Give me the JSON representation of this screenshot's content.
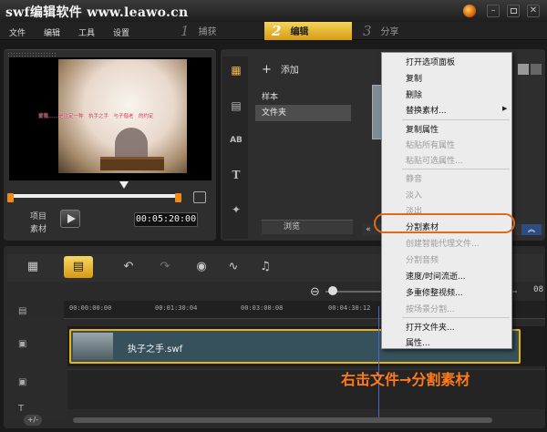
{
  "window": {
    "title": "swf编辑软件 www.leawo.cn",
    "minimize_glyph": "–",
    "close_glyph": "✕"
  },
  "menubar": [
    "文件",
    "编辑",
    "工具",
    "设置"
  ],
  "steps": [
    {
      "num": "1",
      "label": "捕获"
    },
    {
      "num": "2",
      "label": "编辑"
    },
    {
      "num": "3",
      "label": "分享"
    }
  ],
  "preview": {
    "subtitle": "爱我……是注定一种　执手之手　与子偕老　的约定",
    "project_label": "项目",
    "clip_label": "素材",
    "timecode": "00:05:20:00"
  },
  "library": {
    "add_label": "添加",
    "categories": [
      "样本",
      "文件夹"
    ],
    "browse_label": "浏览",
    "icons": [
      "media-icon",
      "transition-icon",
      "title-ab-icon",
      "text-t-icon",
      "effect-icon"
    ]
  },
  "context_menu": {
    "items": [
      {
        "label": "打开选项面板",
        "enabled": true
      },
      {
        "label": "复制",
        "enabled": true
      },
      {
        "label": "删除",
        "enabled": true
      },
      {
        "label": "替换素材...",
        "enabled": true,
        "submenu": true
      },
      {
        "label": "复制属性",
        "enabled": true
      },
      {
        "label": "粘贴所有属性",
        "enabled": false
      },
      {
        "label": "粘贴可选属性...",
        "enabled": false
      },
      {
        "label": "静音",
        "enabled": false
      },
      {
        "label": "淡入",
        "enabled": false
      },
      {
        "label": "淡出",
        "enabled": false
      },
      {
        "label": "分割素材",
        "enabled": true,
        "highlighted": true
      },
      {
        "label": "创建智能代理文件...",
        "enabled": false
      },
      {
        "label": "分割音频",
        "enabled": false
      },
      {
        "label": "速度/时间流逝...",
        "enabled": true
      },
      {
        "label": "多重修整视频...",
        "enabled": true
      },
      {
        "label": "按场景分割...",
        "enabled": false
      },
      {
        "label": "打开文件夹...",
        "enabled": true
      },
      {
        "label": "属性...",
        "enabled": true
      }
    ]
  },
  "timeline": {
    "ruler_ticks": [
      "00:00:00:00",
      "00:01:30:04",
      "00:03:00:08",
      "00:04:30:12"
    ],
    "zoom_timecode": "08",
    "clip_name": "执子之手.swf",
    "caption": "右击文件→分割素材"
  },
  "colors": {
    "accent": "#e8b215",
    "highlight_ring": "#e06a1a",
    "caption": "#ff7a1a"
  }
}
